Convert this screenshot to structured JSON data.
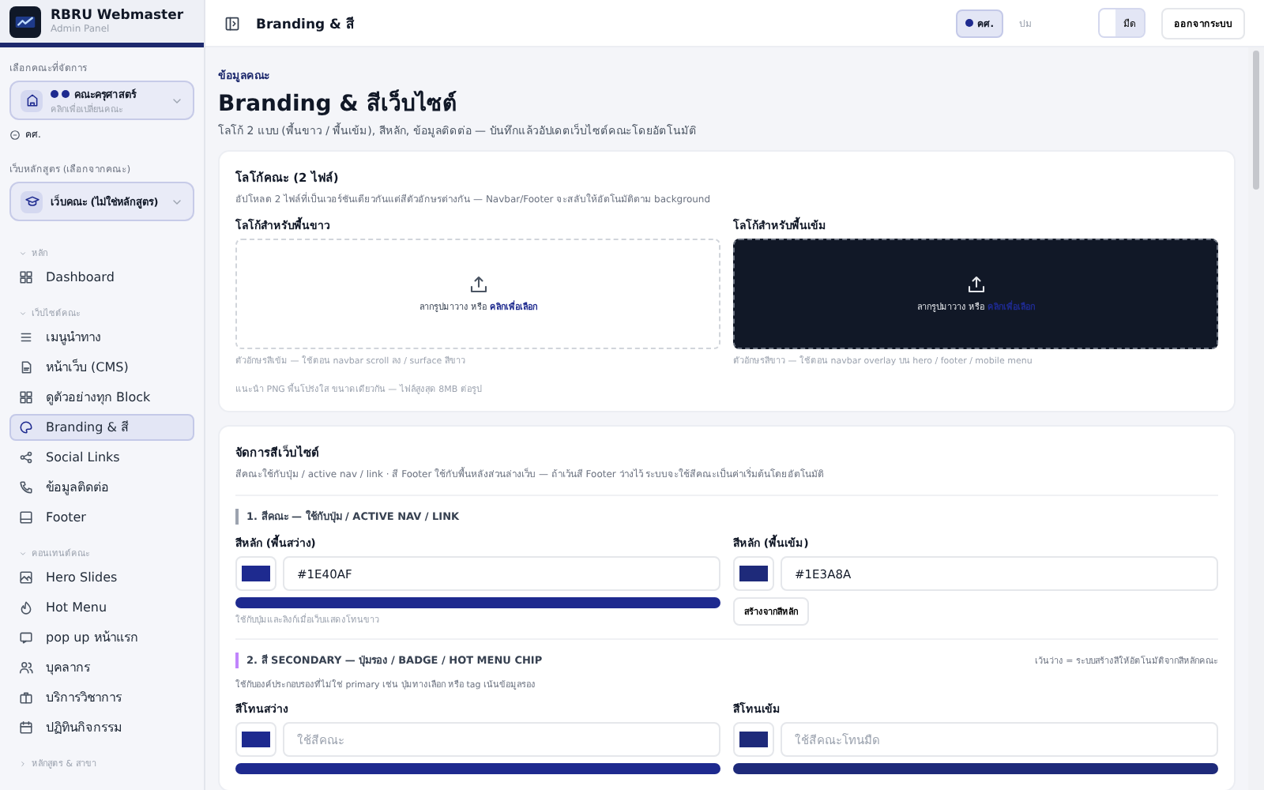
{
  "sidebar": {
    "app_name": "RBRU Webmaster",
    "app_subtitle": "Admin Panel",
    "faculty_label": "เลือกคณะที่จัดการ",
    "faculty_select": {
      "value": "คณะครุศาสตร์",
      "hint": "คลิกเพื่อเปลี่ยนคณะ"
    },
    "faculty_code": "คศ.",
    "program_label": "เว็บหลักสูตร (เลือกจากคณะ)",
    "program_select": {
      "value": "เว็บคณะ (ไม่ใช่หลักสูตร)"
    },
    "groups": [
      {
        "title": "หลัก",
        "expanded": true,
        "items": [
          {
            "label": "Dashboard",
            "selected": false
          }
        ]
      },
      {
        "title": "เว็บไซต์คณะ",
        "expanded": true,
        "items": [
          {
            "label": "เมนูนำทาง",
            "selected": false
          },
          {
            "label": "หน้าเว็บ (CMS)",
            "selected": false
          },
          {
            "label": "ดูตัวอย่างทุก Block",
            "selected": false
          },
          {
            "label": "Branding & สี",
            "selected": true
          },
          {
            "label": "Social Links",
            "selected": false
          },
          {
            "label": "ข้อมูลติดต่อ",
            "selected": false
          },
          {
            "label": "Footer",
            "selected": false
          }
        ]
      },
      {
        "title": "คอนเทนต์คณะ",
        "expanded": true,
        "items": [
          {
            "label": "Hero Slides",
            "selected": false
          },
          {
            "label": "Hot Menu",
            "selected": false
          },
          {
            "label": "pop up หน้าแรก",
            "selected": false
          },
          {
            "label": "บุคลากร",
            "selected": false
          },
          {
            "label": "บริการวิชาการ",
            "selected": false
          },
          {
            "label": "ปฏิทินกิจกรรม",
            "selected": false
          }
        ]
      },
      {
        "title": "หลักสูตร & สาขา",
        "expanded": false
      }
    ]
  },
  "topbar": {
    "title": "Branding & สี",
    "faculty_chip": "คศ.",
    "mode_label": "ปม",
    "theme_toggle": [
      {
        "selected": false
      },
      {
        "label": "มืด",
        "selected": true
      }
    ],
    "logout": "ออกจากระบบ"
  },
  "page": {
    "eyebrow": "ข้อมูลคณะ",
    "title": "Branding & สีเว็บไซต์",
    "subtitle": "โลโก้ 2 แบบ (พื้นขาว / พื้นเข้ม), สีหลัก, ข้อมูลติดต่อ — บันทึกแล้วอัปเดตเว็บไซต์คณะโดยอัตโนมัติ"
  },
  "logo_card": {
    "title": "โลโก้คณะ (2 ไฟล์)",
    "description": "อัปโหลด 2 ไฟล์ที่เป็นเวอร์ชันเดียวกันแต่สีตัวอักษรต่างกัน — Navbar/Footer จะสลับให้อัตโนมัติตาม background",
    "uploads": [
      {
        "label": "โลโก้สำหรับพื้นขาว",
        "kind": "light",
        "prompt": "ลากรูปมาวาง หรือ **คลิกเพื่อเลือก**",
        "hint": "ตัวอักษรสีเข้ม — ใช้ตอน navbar scroll ลง / surface สีขาว"
      },
      {
        "label": "โลโก้สำหรับพื้นเข้ม",
        "kind": "dark",
        "prompt": "ลากรูปมาวาง หรือ **คลิกเพื่อเลือก**",
        "hint": "ตัวอักษรสีขาว — ใช้ตอน navbar overlay บน hero / footer / mobile menu"
      }
    ],
    "note": "แนะนำ PNG พื้นโปร่งใส ขนาดเดียวกัน — ไฟล์สูงสุด 8MB ต่อรูป"
  },
  "color_card": {
    "title": "จัดการสีเว็บไซต์",
    "description": "สีคณะใช้กับปุ่ม / active nav / link · สี Footer ใช้กับพื้นหลังส่วนล่างเว็บ — ถ้าเว้นสี Footer ว่างไว้ ระบบจะใช้สีคณะเป็นค่าเริ่มต้นโดยอัตโนมัติ",
    "sections": [
      {
        "heading": "1. สีคณะ — ใช้กับปุ่ม / ACTIVE NAV / LINK",
        "color": "#9ca3af",
        "fields": [
          {
            "label": "สีหลัก (พื้นสว่าง)",
            "color": "#1e2a8f",
            "value": "#1E40AF",
            "kind": "preview",
            "hint": "ใช้กับปุ่มและลิงก์เมื่อเว็บแสดงโทนขาว"
          },
          {
            "label": "สีหลัก (พื้นเข้ม)",
            "color": "#1e2a7a",
            "value": "#1E3A8A",
            "kind": "action",
            "action": "สร้างจากสีหลัก"
          }
        ]
      },
      {
        "heading": "2. สี SECONDARY — ปุ่มรอง / BADGE / HOT MENU CHIP",
        "color": "#c084fc",
        "note": "เว้นว่าง = ระบบสร้างสีให้อัตโนมัติจากสีหลักคณะ",
        "description": "ใช้กับองค์ประกอบรองที่ไม่ใช่ primary เช่น ปุ่มทางเลือก หรือ tag เน้นข้อมูลรอง",
        "fields": [
          {
            "label": "สีโทนสว่าง",
            "color": "#1e2a8f",
            "placeholder": "ใช้สีคณะ",
            "kind": "preview"
          },
          {
            "label": "สีโทนเข้ม",
            "color": "#1e2a7a",
            "placeholder": "ใช้สีคณะโทนมืด",
            "kind": "preview"
          }
        ]
      }
    ]
  }
}
